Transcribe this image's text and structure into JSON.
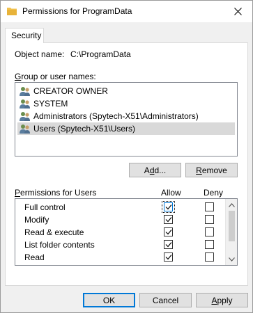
{
  "window": {
    "title": "Permissions for ProgramData"
  },
  "tabs": [
    {
      "label": "Security"
    }
  ],
  "object": {
    "label": "Object name:",
    "value": "C:\\ProgramData"
  },
  "groups": {
    "label_accel": "G",
    "label_rest": "roup or user names:",
    "items": [
      {
        "label": "CREATOR OWNER",
        "selected": false
      },
      {
        "label": "SYSTEM",
        "selected": false
      },
      {
        "label": "Administrators (Spytech-X51\\Administrators)",
        "selected": false
      },
      {
        "label": "Users (Spytech-X51\\Users)",
        "selected": true
      }
    ]
  },
  "buttons": {
    "add_pre": "A",
    "add_accel": "d",
    "add_post": "d...",
    "remove_accel": "R",
    "remove_post": "emove",
    "ok": "OK",
    "cancel": "Cancel",
    "apply_accel": "A",
    "apply_post": "pply"
  },
  "permissions": {
    "label_accel": "P",
    "label_rest": "ermissions for Users",
    "allow_header": "Allow",
    "deny_header": "Deny",
    "rows": [
      {
        "name": "Full control",
        "allow": true,
        "deny": false,
        "focused": true
      },
      {
        "name": "Modify",
        "allow": true,
        "deny": false
      },
      {
        "name": "Read & execute",
        "allow": true,
        "deny": false
      },
      {
        "name": "List folder contents",
        "allow": true,
        "deny": false
      },
      {
        "name": "Read",
        "allow": true,
        "deny": false
      },
      {
        "name": "",
        "allow": true,
        "deny": false
      }
    ]
  },
  "colors": {
    "accent": "#0078d7",
    "selection": "#d9d9d9",
    "folder": "#f1c14d"
  }
}
